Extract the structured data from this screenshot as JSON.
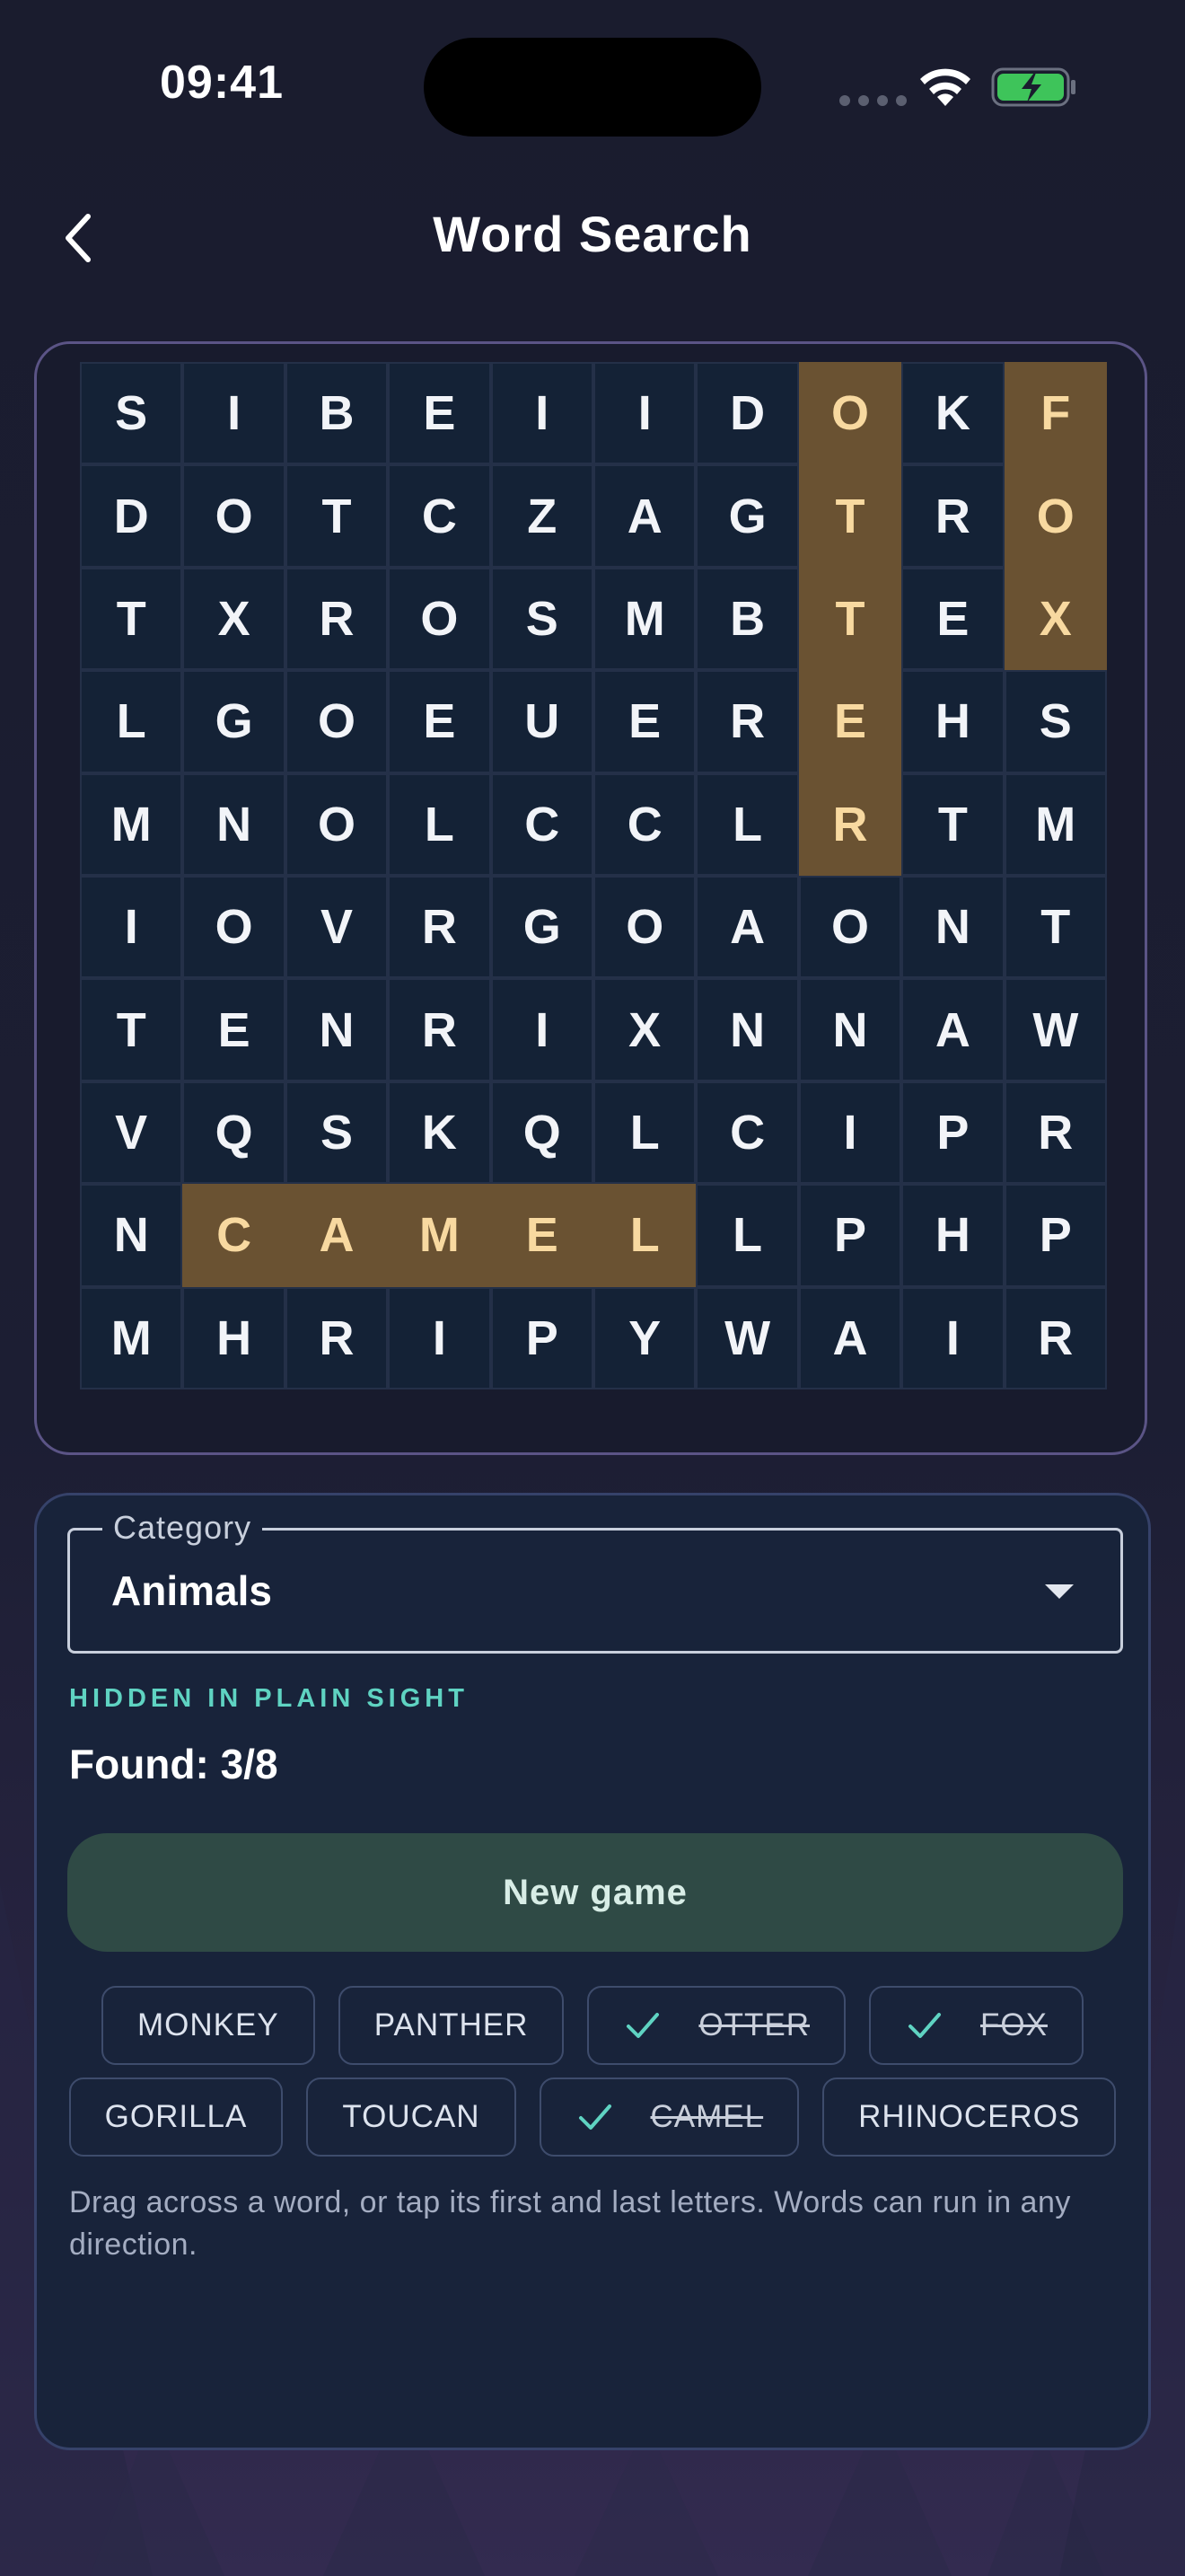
{
  "status_bar": {
    "time": "09:41"
  },
  "header": {
    "title": "Word Search",
    "back_icon": "chevron-left-icon"
  },
  "grid": {
    "rows": [
      [
        "S",
        "I",
        "B",
        "E",
        "I",
        "I",
        "D",
        "O",
        "K",
        "F"
      ],
      [
        "D",
        "O",
        "T",
        "C",
        "Z",
        "A",
        "G",
        "T",
        "R",
        "O"
      ],
      [
        "T",
        "X",
        "R",
        "O",
        "S",
        "M",
        "B",
        "T",
        "E",
        "X"
      ],
      [
        "L",
        "G",
        "O",
        "E",
        "U",
        "E",
        "R",
        "E",
        "H",
        "S"
      ],
      [
        "M",
        "N",
        "O",
        "L",
        "C",
        "C",
        "L",
        "R",
        "T",
        "M"
      ],
      [
        "I",
        "O",
        "V",
        "R",
        "G",
        "O",
        "A",
        "O",
        "N",
        "T"
      ],
      [
        "T",
        "E",
        "N",
        "R",
        "I",
        "X",
        "N",
        "N",
        "A",
        "W"
      ],
      [
        "V",
        "Q",
        "S",
        "K",
        "Q",
        "L",
        "C",
        "I",
        "P",
        "R"
      ],
      [
        "N",
        "C",
        "A",
        "M",
        "E",
        "L",
        "L",
        "P",
        "H",
        "P"
      ],
      [
        "M",
        "H",
        "R",
        "I",
        "P",
        "Y",
        "W",
        "A",
        "I",
        "R"
      ]
    ],
    "highlighted_cells": [
      [
        0,
        7
      ],
      [
        1,
        7
      ],
      [
        2,
        7
      ],
      [
        3,
        7
      ],
      [
        4,
        7
      ],
      [
        0,
        9
      ],
      [
        1,
        9
      ],
      [
        2,
        9
      ],
      [
        8,
        1
      ],
      [
        8,
        2
      ],
      [
        8,
        3
      ],
      [
        8,
        4
      ],
      [
        8,
        5
      ]
    ],
    "highlight_color": "#6a5232",
    "cell_color": "#142236"
  },
  "controls": {
    "category_label": "Category",
    "category_value": "Animals",
    "subtitle": "HIDDEN IN PLAIN SIGHT",
    "found_text": "Found: 3/8",
    "new_game_label": "New game",
    "help_text": "Drag across a word, or tap its first and last letters. Words can run in any direction."
  },
  "words": [
    {
      "label": "MONKEY",
      "found": false
    },
    {
      "label": "PANTHER",
      "found": false
    },
    {
      "label": "OTTER",
      "found": true
    },
    {
      "label": "FOX",
      "found": true
    },
    {
      "label": "GORILLA",
      "found": false
    },
    {
      "label": "TOUCAN",
      "found": false
    },
    {
      "label": "CAMEL",
      "found": true
    },
    {
      "label": "RHINOCEROS",
      "found": false
    }
  ],
  "colors": {
    "accent_teal": "#5fd3c2",
    "new_game_bg": "#2f4a45",
    "battery_green": "#3ec45a"
  }
}
